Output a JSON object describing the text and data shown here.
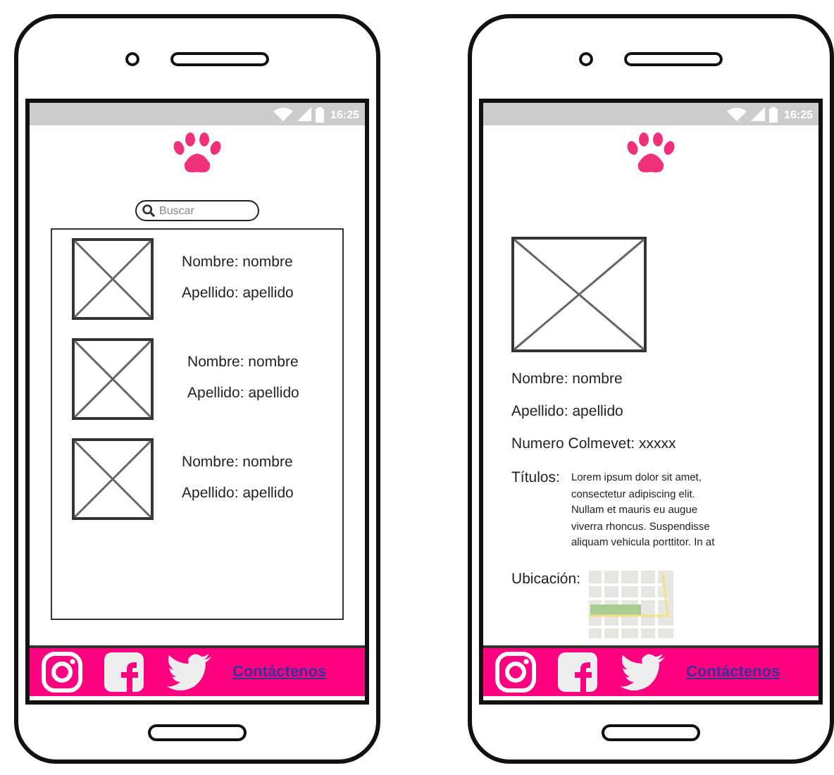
{
  "phones": [
    {
      "kind": "list",
      "status_time": "16:25",
      "search": {
        "placeholder": "Buscar"
      },
      "items": [
        {
          "name": "Nombre: nombre",
          "surname": "Apellido: apellido"
        },
        {
          "name": "Nombre: nombre",
          "surname": "Apellido: apellido"
        },
        {
          "name": "Nombre: nombre",
          "surname": "Apellido: apellido"
        }
      ],
      "footer": {
        "link": "Contáctenos"
      }
    },
    {
      "kind": "detail",
      "status_time": "16:25",
      "fields": [
        "Nombre: nombre",
        "Apellido: apellido",
        "Numero Colmevet: xxxxx"
      ],
      "titles": {
        "label": "Títulos:",
        "text": "Lorem ipsum dolor sit amet, consectetur adipiscing elit. Nullam et mauris eu augue viverra rhoncus. Suspendisse aliquam vehicula porttitor. In at"
      },
      "location": {
        "label": "Ubicación:"
      },
      "footer": {
        "link": "Contáctenos"
      }
    }
  ]
}
